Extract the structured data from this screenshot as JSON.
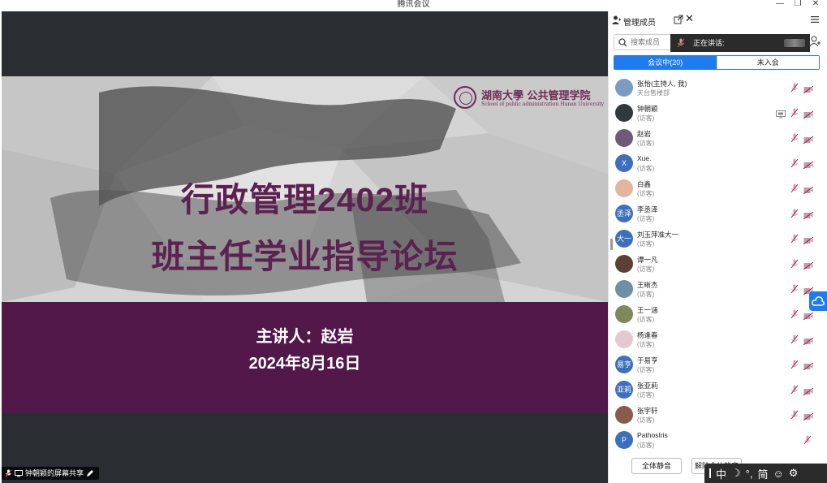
{
  "window": {
    "title": "腾讯会议",
    "minimize": "—",
    "restore": "❐",
    "close": "✕"
  },
  "slide": {
    "logo_cn": "湖南大學 公共管理学院",
    "logo_en": "School of public administration Hunan University",
    "title_line1": "行政管理2402班",
    "title_line2": "班主任学业指导论坛",
    "speaker": "主讲人：赵岩",
    "date": "2024年8月16日"
  },
  "share_label": "钟朝颖的屏幕共享",
  "panel": {
    "title": "管理成员",
    "search_placeholder": "搜索成员",
    "speaking_label": "正在讲话:",
    "tabs": [
      {
        "label": "会议中(20)",
        "active": true
      },
      {
        "label": "未入会",
        "active": false
      }
    ],
    "members": [
      {
        "name": "张怡(主持人, 我)",
        "role": "天台售楼部",
        "avatar_text": "",
        "avatar_color": "#7a9cc0",
        "screen": false
      },
      {
        "name": "钟朝颖",
        "role": "(访客)",
        "avatar_text": "",
        "avatar_color": "#2f3b3a",
        "screen": true
      },
      {
        "name": "赵岩",
        "role": "(访客)",
        "avatar_text": "",
        "avatar_color": "#6e5a78",
        "screen": false
      },
      {
        "name": "Xue.",
        "role": "(访客)",
        "avatar_text": "X",
        "avatar_color": "#3d6fbf",
        "screen": false
      },
      {
        "name": "白鑫",
        "role": "(访客)",
        "avatar_text": "",
        "avatar_color": "#e3b59c",
        "screen": false
      },
      {
        "name": "李丞泽",
        "role": "(访客)",
        "avatar_text": "丞泽",
        "avatar_color": "#3d6fbf",
        "screen": false
      },
      {
        "name": "刘玉萍准大一",
        "role": "(访客)",
        "avatar_text": "大一",
        "avatar_color": "#3d6fbf",
        "screen": false
      },
      {
        "name": "谭一凡",
        "role": "(访客)",
        "avatar_text": "",
        "avatar_color": "#5b4033",
        "screen": false
      },
      {
        "name": "王晰杰",
        "role": "(访客)",
        "avatar_text": "",
        "avatar_color": "#6d8fa8",
        "screen": false
      },
      {
        "name": "王一涵",
        "role": "(访客)",
        "avatar_text": "",
        "avatar_color": "#7c8a5a",
        "screen": false
      },
      {
        "name": "杨逢春",
        "role": "(访客)",
        "avatar_text": "",
        "avatar_color": "#e6c8d0",
        "screen": false
      },
      {
        "name": "于易亨",
        "role": "(访客)",
        "avatar_text": "易亨",
        "avatar_color": "#3d6fbf",
        "screen": false
      },
      {
        "name": "张亚莉",
        "role": "(访客)",
        "avatar_text": "亚莉",
        "avatar_color": "#3d6fbf",
        "screen": false
      },
      {
        "name": "张宇轩",
        "role": "(访客)",
        "avatar_text": "",
        "avatar_color": "#8a5a4a",
        "screen": false
      },
      {
        "name": "PathosIris",
        "role": "(访客)",
        "avatar_text": "P",
        "avatar_color": "#3d6fbf",
        "screen": false
      }
    ],
    "mute_all_label": "全体静音",
    "unmute_all_label": "解除全体静音"
  },
  "ime": {
    "mode": "中",
    "simplified": "简"
  }
}
